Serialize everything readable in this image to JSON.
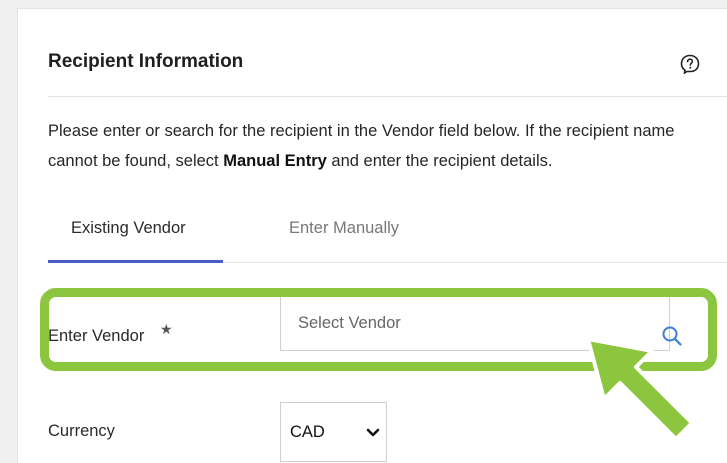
{
  "section": {
    "title": "Recipient Information",
    "help_icon": "question-circle-icon",
    "description_start": "Please enter or search for the recipient in the Vendor field below. If the recipient name cannot be found, select ",
    "description_bold": "Manual Entry",
    "description_end": " and enter the recipient details."
  },
  "tabs": [
    {
      "label": "Existing Vendor",
      "active": true
    },
    {
      "label": "Enter Manually",
      "active": false
    }
  ],
  "vendor_field": {
    "label": "Enter Vendor",
    "required_mark": "★",
    "placeholder": "Select Vendor",
    "icon": "search-icon"
  },
  "currency_field": {
    "label": "Currency",
    "value": "CAD",
    "icon": "chevron-down-icon"
  },
  "colors": {
    "highlight": "#8cc63f",
    "tab_accent": "#4a5bc4",
    "search_icon": "#3b7ddd"
  },
  "annotation": {
    "arrow_icon": "pointer-arrow-icon"
  }
}
